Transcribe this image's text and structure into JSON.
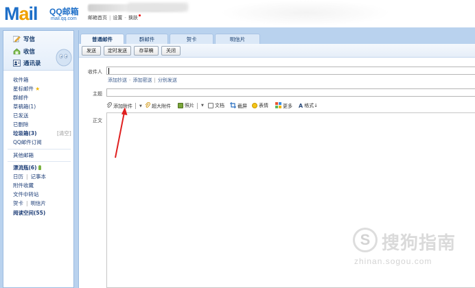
{
  "header": {
    "logo_text": "Mail",
    "logo_brand": "QQ邮箱",
    "logo_domain": "mail.qq.com",
    "links": [
      "邮箱首页",
      "设置",
      "换肤"
    ]
  },
  "sidebar": {
    "actions": [
      {
        "label": "写信",
        "icon": "pencil-icon"
      },
      {
        "label": "收信",
        "icon": "inbox-icon"
      },
      {
        "label": "通讯录",
        "icon": "contacts-icon"
      }
    ],
    "folders": [
      {
        "label": "收件箱"
      },
      {
        "label": "星标邮件",
        "star": "★"
      },
      {
        "label": "群邮件"
      },
      {
        "label": "草稿箱(1)"
      },
      {
        "label": "已发送"
      },
      {
        "label": "已删除"
      },
      {
        "label": "垃圾箱(3)",
        "bold": true,
        "clear_label": "[清空]"
      },
      {
        "label": "QQ邮件订阅"
      }
    ],
    "other_label": "其他邮箱",
    "bottle_label": "漂流瓶(6)",
    "extras": [
      {
        "left": "日历",
        "right": "记事本"
      },
      {
        "left": "附件收藏"
      },
      {
        "left": "文件中转站"
      },
      {
        "left": "贺卡",
        "right": "明信片"
      }
    ],
    "reading_label": "阅读空间(55)"
  },
  "tabs": [
    {
      "label": "普通邮件",
      "active": true
    },
    {
      "label": "群邮件"
    },
    {
      "label": "贺卡"
    },
    {
      "label": "明信片"
    }
  ],
  "toolbar": {
    "send": "发送",
    "schedule": "定时发送",
    "save_draft": "存草稿",
    "close": "关闭"
  },
  "compose": {
    "to_label": "收件人",
    "to_value": "",
    "cc_links": [
      "添加抄送",
      "添加密送",
      "分别发送"
    ],
    "subject_label": "主题",
    "subject_value": "",
    "body_label": "正文"
  },
  "editor_toolbar": {
    "attach": "添加附件",
    "big_attach": "超大附件",
    "photo": "照片",
    "doc": "文档",
    "screenshot": "截屏",
    "emoji": "表情",
    "more": "更多",
    "format": "格式↓"
  },
  "watermark": {
    "cn": "搜狗指南",
    "url": "zhinan.sogou.com",
    "symbol": "S"
  },
  "colors": {
    "frame_blue": "#b9d2ee",
    "link_blue": "#1f3f78",
    "arrow_red": "#e02020",
    "logo_blue": "#1e6fc8"
  }
}
